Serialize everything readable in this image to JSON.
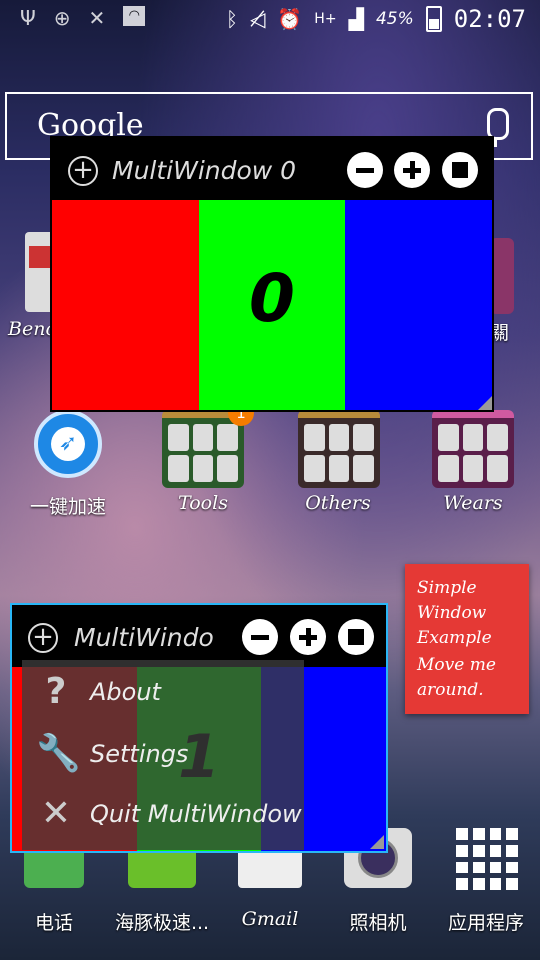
{
  "status_bar": {
    "battery": "45%",
    "time": "02:07",
    "network": "H+",
    "icons": [
      "usb-icon",
      "add-circle-icon",
      "close-icon",
      "wifi-icon",
      "bluetooth-icon",
      "mute-icon",
      "alarm-icon",
      "network-icon",
      "signal-icon",
      "battery-icon"
    ]
  },
  "google_search": {
    "label": "Google",
    "icon": "mic-icon"
  },
  "homescreen": {
    "row1_partial": [
      "Benc",
      "關"
    ],
    "apps_row2": [
      {
        "label": "一键加速"
      },
      {
        "label": "Tools"
      },
      {
        "label": "Others"
      },
      {
        "label": "Wears"
      }
    ],
    "badge": "1",
    "dock": [
      {
        "label": "电话"
      },
      {
        "label": "海豚极速..."
      },
      {
        "label": "Gmail"
      },
      {
        "label": "照相机"
      },
      {
        "label": "应用程序"
      }
    ]
  },
  "multiwindow0": {
    "title": "MultiWindow 0",
    "content_text": "0",
    "colors": [
      "#ff0000",
      "#00ff00",
      "#0000ff"
    ]
  },
  "multiwindow1": {
    "title": "MultiWindo",
    "content_text": "1",
    "menu": [
      {
        "label": "About",
        "icon": "question-icon"
      },
      {
        "label": "Settings",
        "icon": "wrench-icon"
      },
      {
        "label": "Quit MultiWindow",
        "icon": "close-icon"
      }
    ]
  },
  "note_widget": {
    "title_lines": [
      "Simple",
      "Window",
      "Example"
    ],
    "body_lines": [
      "Move me",
      "around."
    ],
    "color": "#e53935"
  }
}
